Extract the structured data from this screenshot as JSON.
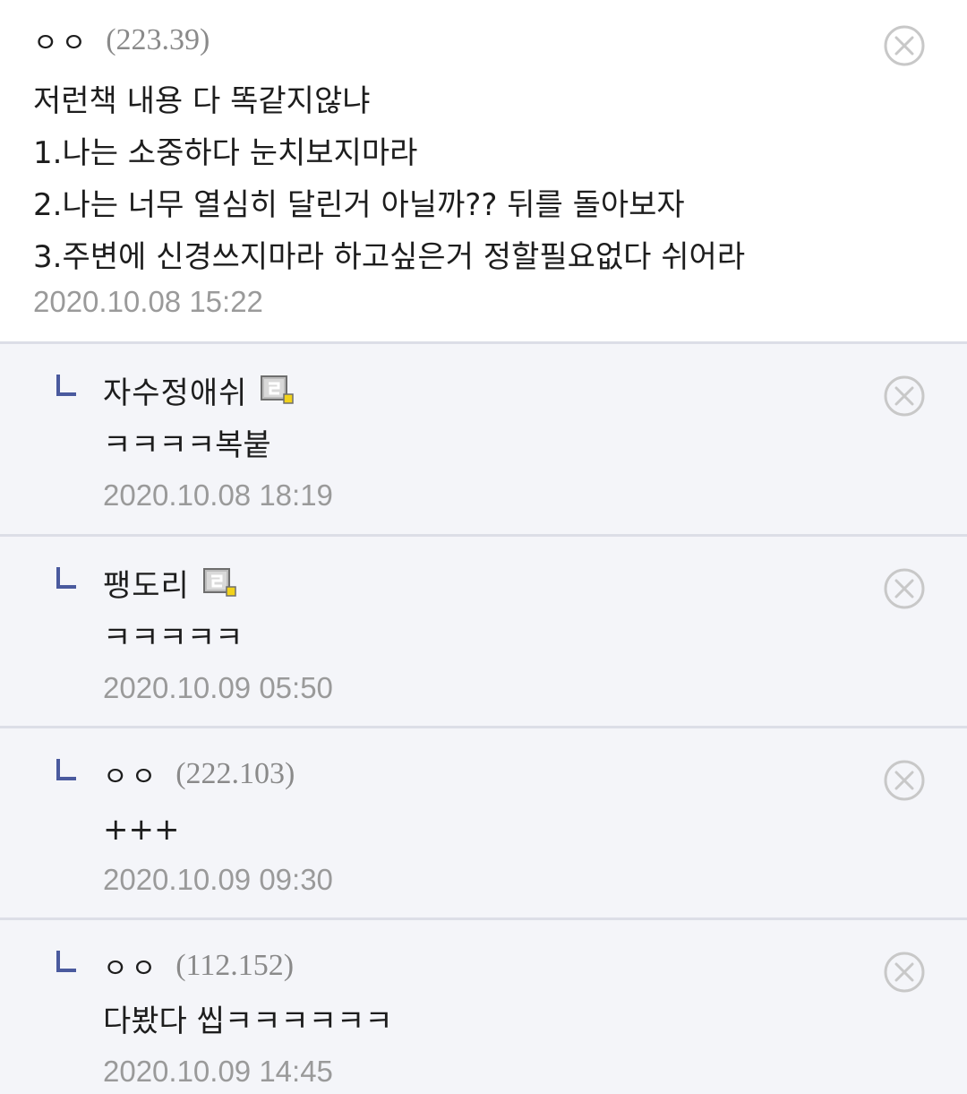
{
  "comment": {
    "nick": "ㅇㅇ",
    "ip": "(223.39)",
    "lines": [
      "저런책 내용 다 똑같지않냐",
      "1.나는 소중하다 눈치보지마라",
      "2.나는 너무 열심히 달린거 아닐까?? 뒤를 돌아보자",
      "3.주변에 신경쓰지마라 하고싶은거 정할필요없다 쉬어라"
    ],
    "date": "2020.10.08 15:22"
  },
  "replies": [
    {
      "nick": "자수정애쉬",
      "ip": "",
      "member_icon": "fixed-nick-icon",
      "body": "ㅋㅋㅋㅋ복붙",
      "date": "2020.10.08 18:19"
    },
    {
      "nick": "팽도리",
      "ip": "",
      "member_icon": "fixed-nick-icon",
      "body": "ㅋㅋㅋㅋㅋ",
      "date": "2020.10.09 05:50"
    },
    {
      "nick": "ㅇㅇ",
      "ip": "(222.103)",
      "member_icon": "",
      "body": "+++",
      "date": "2020.10.09 09:30"
    },
    {
      "nick": "ㅇㅇ",
      "ip": "(112.152)",
      "member_icon": "",
      "body": "다봤다 씹ㅋㅋㅋㅋㅋㅋ",
      "date": "2020.10.09 14:45"
    }
  ],
  "icons": {
    "delete": "close-circle-icon",
    "reply_mark": "reply-arrow-icon"
  },
  "colors": {
    "reply_background": "#f4f5f9",
    "reply_mark": "#4a5a9e",
    "muted_text": "#9a9a9a"
  }
}
